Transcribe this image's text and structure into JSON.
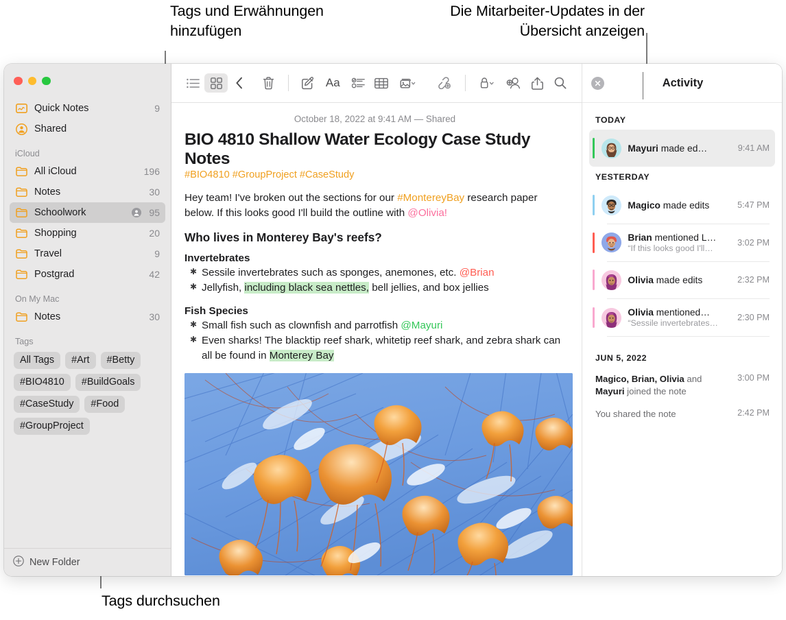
{
  "callouts": {
    "left": "Tags und Erwähnungen hinzufügen",
    "right": "Die Mitarbeiter-Updates in der Übersicht anzeigen",
    "bottom": "Tags durchsuchen"
  },
  "sidebar": {
    "top_items": [
      {
        "label": "Quick Notes",
        "count": "9",
        "icon": "quick-note-icon",
        "shared": false
      },
      {
        "label": "Shared",
        "count": "",
        "icon": "shared-person-icon",
        "shared": false
      }
    ],
    "sections": [
      {
        "header": "iCloud",
        "items": [
          {
            "label": "All iCloud",
            "count": "196",
            "icon": "folder-icon",
            "shared": false,
            "selected": false
          },
          {
            "label": "Notes",
            "count": "30",
            "icon": "folder-icon",
            "shared": false,
            "selected": false
          },
          {
            "label": "Schoolwork",
            "count": "95",
            "icon": "folder-icon",
            "shared": true,
            "selected": true
          },
          {
            "label": "Shopping",
            "count": "20",
            "icon": "folder-icon",
            "shared": false,
            "selected": false
          },
          {
            "label": "Travel",
            "count": "9",
            "icon": "folder-icon",
            "shared": false,
            "selected": false
          },
          {
            "label": "Postgrad",
            "count": "42",
            "icon": "folder-icon",
            "shared": false,
            "selected": false
          }
        ]
      },
      {
        "header": "On My Mac",
        "items": [
          {
            "label": "Notes",
            "count": "30",
            "icon": "folder-icon",
            "shared": false,
            "selected": false
          }
        ]
      }
    ],
    "tags_header": "Tags",
    "tags": [
      "All Tags",
      "#Art",
      "#Betty",
      "#BIO4810",
      "#BuildGoals",
      "#CaseStudy",
      "#Food",
      "#GroupProject"
    ],
    "footer": "New Folder",
    "accent_folder_color": "#f0a020",
    "selected_row_bg": "#d0cfcf"
  },
  "toolbar": {
    "list_view": "list-view-icon",
    "gallery_view": "gallery-view-icon",
    "back": "back-chevron-icon",
    "delete": "trash-icon",
    "compose": "compose-icon",
    "format": "Aa",
    "checklist": "checklist-icon",
    "table": "table-icon",
    "media": "media-icon",
    "link": "link-icon",
    "lock": "lock-icon",
    "add_people": "add-person-icon",
    "share": "share-icon",
    "search": "search-icon"
  },
  "note": {
    "date": "October 18, 2022 at 9:41 AM — Shared",
    "title": "BIO 4810 Shallow Water Ecology Case Study Notes",
    "tags_line": "#BIO4810 #GroupProject #CaseStudy",
    "intro_1": "Hey team! I've broken out the sections for our ",
    "intro_tag": "#MontereyBay",
    "intro_2": " research paper below. If this looks good I'll build the outline with ",
    "intro_mention": "@Olivia!",
    "heading": "Who lives in Monterey Bay's reefs?",
    "group1_title": "Invertebrates",
    "g1_b1_a": "Sessile invertebrates such as sponges, anemones, etc. ",
    "g1_b1_mention": "@Brian",
    "g1_b2_a": "Jellyfish, ",
    "g1_b2_hl": "including black sea nettles,",
    "g1_b2_b": " bell jellies, and box jellies",
    "group2_title": "Fish Species",
    "g2_b1_a": "Small fish such as clownfish and parrotfish ",
    "g2_b1_mention": "@Mayuri",
    "g2_b2_a": "Even sharks! The blacktip reef shark, whitetip reef shark, and zebra shark can all be found in ",
    "g2_b2_hl": "Monterey Bay",
    "image_alt": "jellyfish-photo",
    "tag_color": "#f0a020",
    "highlight_color": "#c8ecc8"
  },
  "activity": {
    "title": "Activity",
    "close": "close-icon",
    "groups": [
      {
        "label": "TODAY",
        "items": [
          {
            "name": "Mayuri",
            "action": " made ed…",
            "quote": "",
            "time": "9:41 AM",
            "color": "#34c759",
            "avatar_bg": "#b8e5ea",
            "selected": true
          }
        ]
      },
      {
        "label": "YESTERDAY",
        "items": [
          {
            "name": "Magico",
            "action": " made edits",
            "quote": "",
            "time": "5:47 PM",
            "color": "#8fd0f0",
            "avatar_bg": "#cfeafb",
            "selected": false
          },
          {
            "name": "Brian",
            "action": " mentioned L…",
            "quote": "“If this looks good I'll…",
            "time": "3:02 PM",
            "color": "#ff5d52",
            "avatar_bg": "#8fa8e8",
            "selected": false
          },
          {
            "name": "Olivia",
            "action": " made edits",
            "quote": "",
            "time": "2:32 PM",
            "color": "#f9a8cf",
            "avatar_bg": "#f7c9e0",
            "selected": false
          },
          {
            "name": "Olivia",
            "action": " mentioned…",
            "quote": "“Sessile invertebrates…",
            "time": "2:30 PM",
            "color": "#f9a8cf",
            "avatar_bg": "#f7c9e0",
            "selected": false
          }
        ]
      }
    ],
    "older_label": "JUN 5, 2022",
    "older_items": [
      {
        "bold": "Magico, Brian, Olivia",
        "rest": " and ",
        "bold2": "Mayuri",
        "rest2": " joined the note",
        "time": "3:00 PM"
      },
      {
        "bold": "",
        "rest": "You shared the note",
        "bold2": "",
        "rest2": "",
        "time": "2:42 PM"
      }
    ]
  }
}
